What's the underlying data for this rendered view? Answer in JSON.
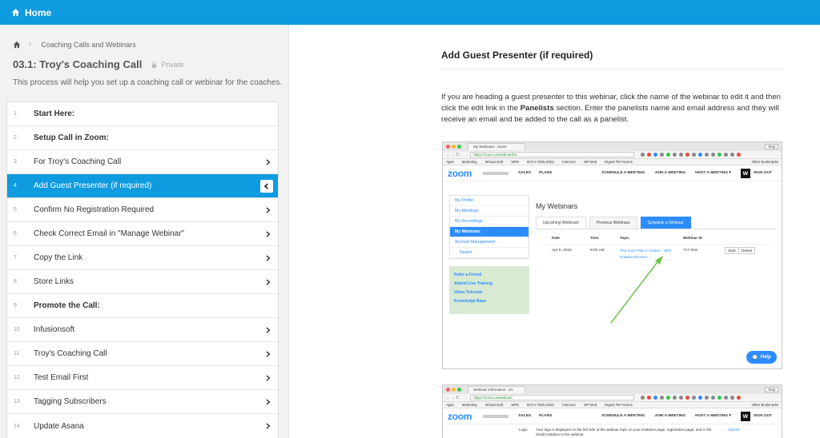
{
  "topbar": {
    "home_label": "Home"
  },
  "breadcrumb": {
    "section": "Coaching Calls and Webinars"
  },
  "process": {
    "title": "03.1: Troy's Coaching Call",
    "privacy": "Private",
    "description": "This process will help you set up a coaching call or webinar for the coaches."
  },
  "steps": [
    {
      "num": "1",
      "label": "Start Here:"
    },
    {
      "num": "2",
      "label": "Setup Call in Zoom:"
    },
    {
      "num": "3",
      "label": "For Troy's Coaching Call"
    },
    {
      "num": "4",
      "label": "Add Guest Presenter (if required)"
    },
    {
      "num": "5",
      "label": "Confirm No Registration Required"
    },
    {
      "num": "6",
      "label": "Check Correct Email in \"Manage Webinar\""
    },
    {
      "num": "7",
      "label": "Copy the Link"
    },
    {
      "num": "8",
      "label": "Store Links"
    },
    {
      "num": "9",
      "label": "Promote the Call:"
    },
    {
      "num": "10",
      "label": "Infusionsoft"
    },
    {
      "num": "11",
      "label": "Troy's Coaching Call"
    },
    {
      "num": "12",
      "label": "Test Email First"
    },
    {
      "num": "13",
      "label": "Tagging Subscribers"
    },
    {
      "num": "14",
      "label": "Update Asana"
    }
  ],
  "content": {
    "heading": "Add Guest Presenter (if required)",
    "para_1": "If you are heading a guest presenter to this webinar, click the name of the webinar to edit it and then click the edit link in the ",
    "para_bold": "Panelists",
    "para_2": " section. Enter the panelists name and email address and they will receive an email and be added to the call as a panelist."
  },
  "shot1": {
    "tab": "My Webinars - Zoom",
    "user": "Troy",
    "url": "https://zoom.us/webinar/list",
    "bookmarks": [
      "Apps",
      "Marketing",
      "InfusionSoft",
      "WPE",
      "BITLY FEELINGS",
      "Intercom",
      "WP Mod",
      "Digest FB Forums"
    ],
    "other_bookmarks": "Other Bookmarks",
    "logo": "zoom",
    "nav_left": [
      "SALES",
      "PLANS"
    ],
    "nav_right": [
      "SCHEDULE A MEETING",
      "JOIN A MEETING",
      "HOST A MEETING ▾"
    ],
    "sign_out": "SIGN OUT",
    "side": [
      "My Profile",
      "My Meetings",
      "My Recordings",
      "My Webinars",
      "Account Management",
      "Report"
    ],
    "side_links": [
      "Refer-a-Friend",
      "Attend Live Training",
      "Video Tutorials",
      "Knowledge Base"
    ],
    "page_title": "My Webinars",
    "tabs": [
      "Upcoming Webinars",
      "Previous Webinars"
    ],
    "schedule_btn": "Schedule a Webinar",
    "cols": [
      "Date",
      "Time",
      "Topic",
      "Webinar ID"
    ],
    "row": {
      "date": "Apr 6, 2016",
      "time": "8:00 AM",
      "topic": "The Care Plan in Action - With Kristina Romero",
      "id": "717-943-"
    },
    "row_buttons": [
      "Start",
      "Delete"
    ],
    "help": "Help"
  },
  "shot2": {
    "tab": "Webinar Information - Zo",
    "user": "Troy",
    "url": "https://zoom.us/webinar/",
    "bookmarks": [
      "Apps",
      "Marketing",
      "InfusionSoft",
      "WPE",
      "BITLY FEELINGS",
      "Intercom",
      "WP Mod",
      "Digest FB Forums"
    ],
    "other_bookmarks": "Other Bookmarks",
    "logo": "zoom",
    "nav_left": [
      "SALES",
      "PLANS"
    ],
    "nav_right": [
      "SCHEDULE A MEETING",
      "JOIN A MEETING",
      "HOST A MEETING ▾"
    ],
    "sign_out": "SIGN OUT",
    "logo_label": "Logo:",
    "logo_text": "Your logo is displayed on the left side of the webinar topic on your invitation page, registration page, and in the email invitation to the webinar.",
    "upload": "Upload"
  }
}
